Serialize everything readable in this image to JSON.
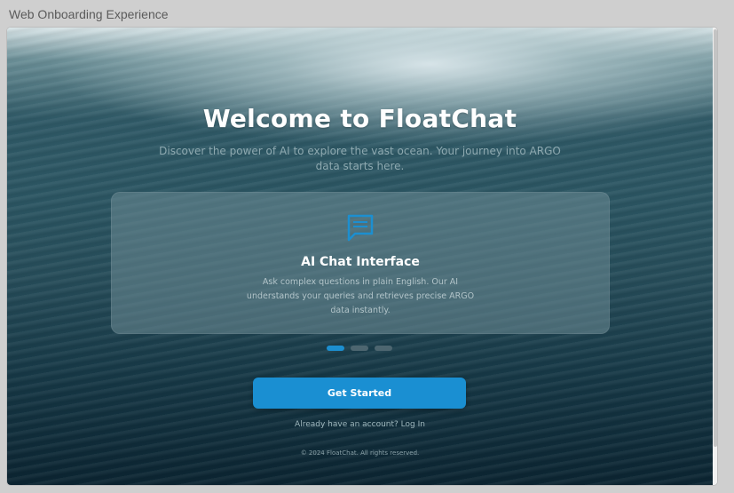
{
  "window": {
    "title": "Web Onboarding Experience"
  },
  "hero": {
    "title": "Welcome to FloatChat",
    "subtitle": "Discover the power of AI to explore the vast ocean. Your journey into ARGO data starts here."
  },
  "card": {
    "icon": "chat-bubble-icon",
    "title": "AI Chat Interface",
    "description": "Ask complex questions in plain English. Our AI understands your queries and retrieves precise ARGO data instantly."
  },
  "carousel": {
    "slides": 3,
    "active_index": 0
  },
  "actions": {
    "get_started": "Get Started",
    "login_prompt": "Already have an account? Log In"
  },
  "footer": {
    "text": "© 2024 FloatChat. All rights reserved."
  },
  "colors": {
    "accent": "#1a8fd2",
    "dot_inactive": "#4d6670"
  }
}
